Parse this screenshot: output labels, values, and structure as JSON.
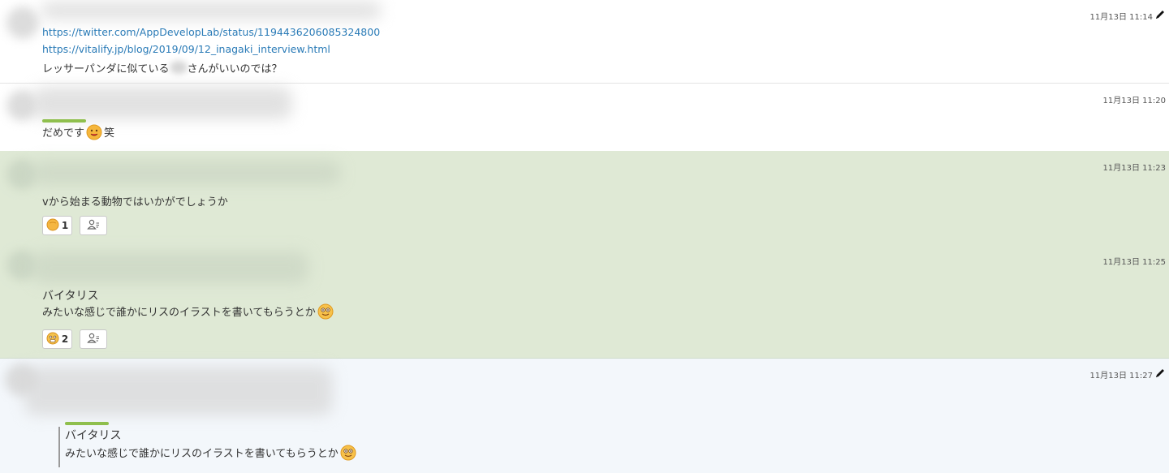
{
  "messages": [
    {
      "timestamp": "11月13日 11:14",
      "edited": true,
      "links": [
        "https://twitter.com/AppDevelopLab/status/1194436206085324800",
        "https://vitalify.jp/blog/2019/09/12_inagaki_interview.html"
      ],
      "text_before": "レッサーパンダに似ている",
      "text_after": "さんがいいのでは？"
    },
    {
      "timestamp": "11月13日 11:20",
      "text": "だめです",
      "emoji": "grimacing-face-icon",
      "text_after": "笑"
    },
    {
      "timestamp": "11月13日 11:23",
      "text": "vから始まる動物ではいかがでしょうか",
      "reactions": [
        {
          "emoji": "orange-face-icon",
          "count": "1"
        }
      ]
    },
    {
      "timestamp": "11月13日 11:25",
      "lines": [
        "バイタリス",
        "みたいな感じで誰かにリスのイラストを書いてもらうとか"
      ],
      "emoji": "smiling-face-icon",
      "reactions": [
        {
          "emoji": "fearful-face-icon",
          "count": "2"
        }
      ]
    },
    {
      "timestamp": "11月13日 11:27",
      "edited": true,
      "quote_lines": [
        "バイタリス",
        "みたいな感じで誰かにリスのイラストを書いてもらうとか"
      ],
      "emoji": "smiling-face-icon"
    }
  ],
  "colors": {
    "link": "#2a7bb7",
    "highlight_bg": "#dfe9d5",
    "quoted_bg": "#f3f7fb"
  }
}
